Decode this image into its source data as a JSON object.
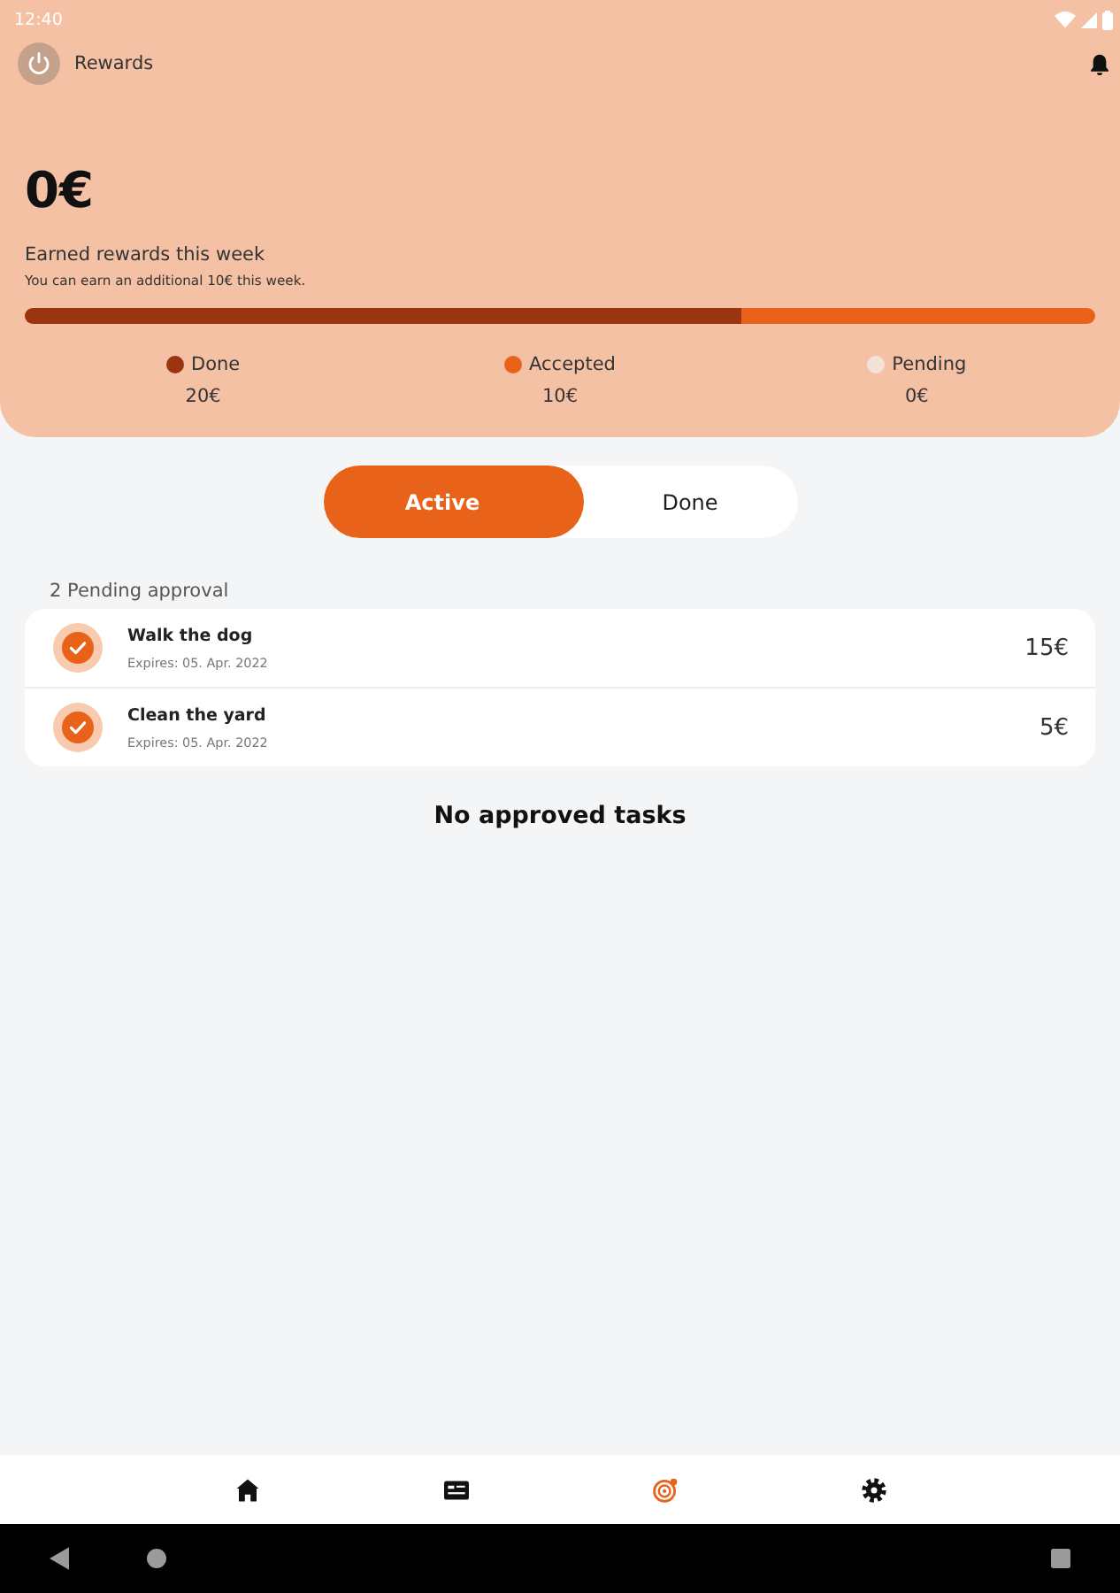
{
  "status_bar": {
    "time": "12:40"
  },
  "header": {
    "title": "Rewards"
  },
  "summary": {
    "amount": "0€",
    "title": "Earned rewards this week",
    "subtitle": "You can earn an additional 10€ this week.",
    "progress": {
      "level": 0.67
    },
    "legend": [
      {
        "label": "Done",
        "value": "20€",
        "color": "#9a3510"
      },
      {
        "label": "Accepted",
        "value": "10€",
        "color": "#e8621a"
      },
      {
        "label": "Pending",
        "value": "0€",
        "color": "#f3e2d8"
      }
    ]
  },
  "tabs": [
    {
      "label": "Active",
      "selected": true
    },
    {
      "label": "Done",
      "selected": false
    }
  ],
  "pending": {
    "heading": "2 Pending approval",
    "tasks": [
      {
        "title": "Walk the dog",
        "expires": "Expires: 05. Apr. 2022",
        "amount": "15€",
        "checked": true
      },
      {
        "title": "Clean the yard",
        "expires": "Expires: 05. Apr. 2022",
        "amount": "5€",
        "checked": true
      }
    ]
  },
  "empty_message": "No approved tasks",
  "bottom_nav": [
    {
      "kind": "home",
      "selected": false
    },
    {
      "kind": "card",
      "selected": false
    },
    {
      "kind": "target",
      "selected": true
    },
    {
      "kind": "gear",
      "selected": false
    }
  ]
}
